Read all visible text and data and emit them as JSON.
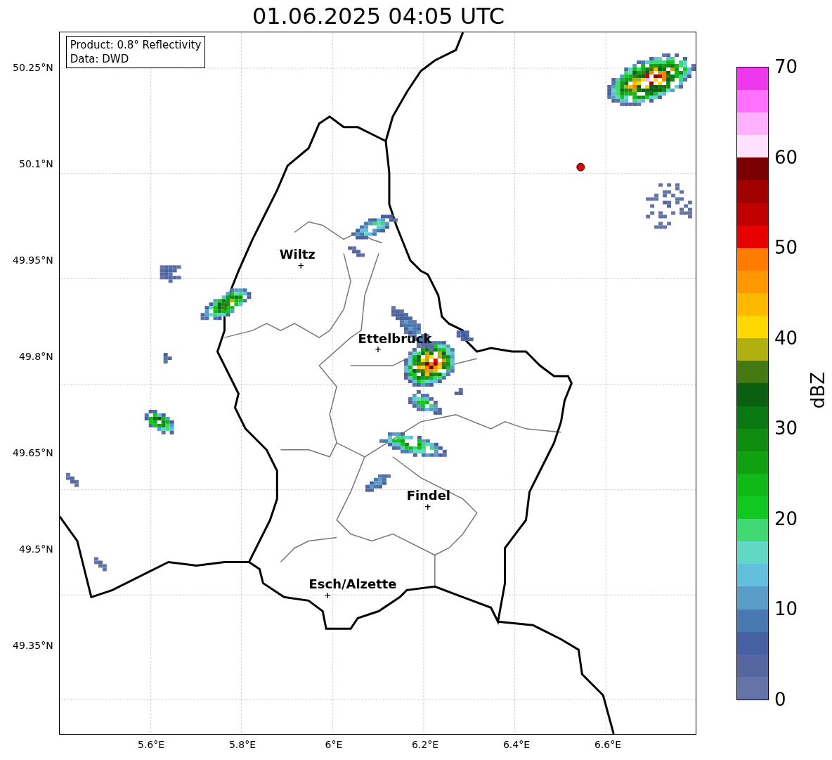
{
  "title": "01.06.2025 04:05 UTC",
  "legend": [
    "Product: 0.8° Reflectivity",
    "Data: DWD"
  ],
  "y_ticks": [
    "50.25°N",
    "50.1°N",
    "49.95°N",
    "49.8°N",
    "49.65°N",
    "49.5°N",
    "49.35°N"
  ],
  "x_ticks": [
    "5.6°E",
    "5.8°E",
    "6°E",
    "6.2°E",
    "6.4°E",
    "6.6°E"
  ],
  "cities": [
    {
      "name": "Wiltz",
      "marker": "+"
    },
    {
      "name": "Ettelbruck",
      "marker": "+"
    },
    {
      "name": "Findel",
      "marker": "+"
    },
    {
      "name": "Esch/Alzette",
      "marker": "+"
    }
  ],
  "colorbar": {
    "label": "dBZ",
    "ticks": [
      "70",
      "60",
      "50",
      "40",
      "30",
      "20",
      "10",
      "0"
    ],
    "bands": [
      {
        "color": "#6473a8"
      },
      {
        "color": "#56669e"
      },
      {
        "color": "#4660a2"
      },
      {
        "color": "#4a78b0"
      },
      {
        "color": "#5a9ec8"
      },
      {
        "color": "#62c0dc"
      },
      {
        "color": "#60d8c4"
      },
      {
        "color": "#40d870"
      },
      {
        "color": "#10c820"
      },
      {
        "color": "#10b818"
      },
      {
        "color": "#10a010"
      },
      {
        "color": "#108c10"
      },
      {
        "color": "#0a7810"
      },
      {
        "color": "#0a6010"
      },
      {
        "color": "#447810"
      },
      {
        "color": "#b0b010"
      },
      {
        "color": "#ffd800"
      },
      {
        "color": "#ffb800"
      },
      {
        "color": "#ff9800"
      },
      {
        "color": "#ff7c00"
      },
      {
        "color": "#e80000"
      },
      {
        "color": "#c00000"
      },
      {
        "color": "#a00000"
      },
      {
        "color": "#780000"
      },
      {
        "color": "#ffe0ff"
      },
      {
        "color": "#ffb0ff"
      },
      {
        "color": "#ff70ff"
      },
      {
        "color": "#ee38ee"
      }
    ]
  }
}
